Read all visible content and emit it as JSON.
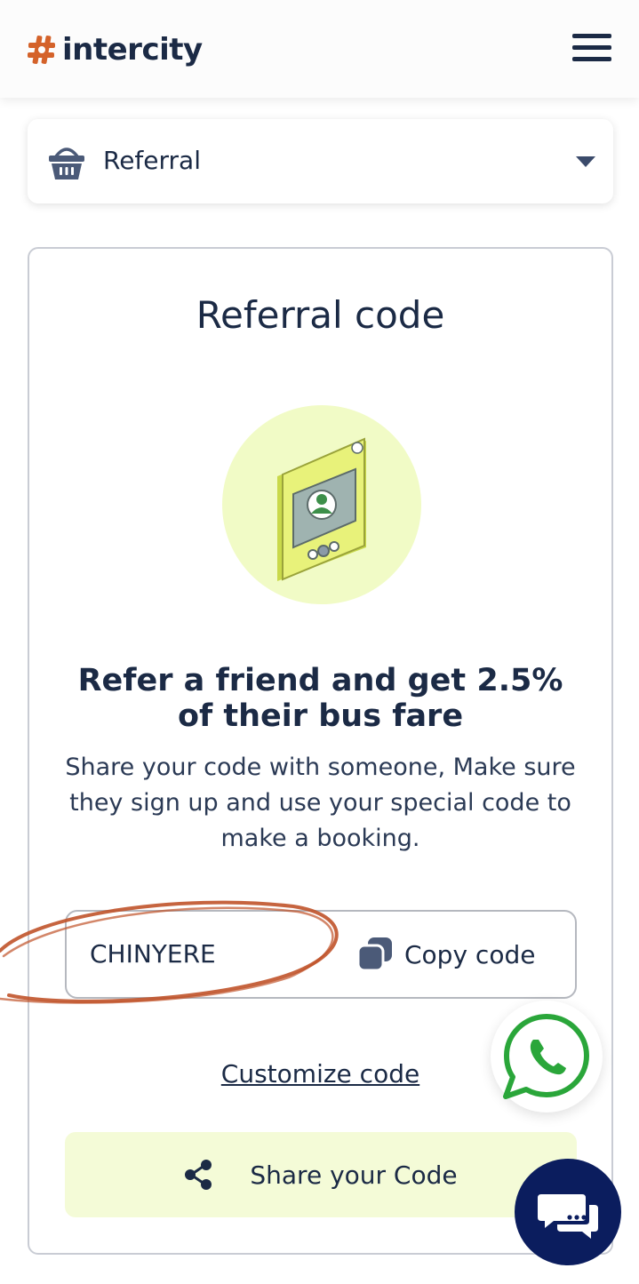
{
  "header": {
    "brand": "intercity",
    "menu_icon": "hamburger-menu-icon"
  },
  "section_select": {
    "icon": "basket-icon",
    "selected": "Referral"
  },
  "referral": {
    "title": "Referral code",
    "headline": "Refer a friend and get 2.5% of their bus fare",
    "description": "Share your code with someone, Make sure they sign up and use your special code to make a booking.",
    "code": "CHINYERE",
    "copy_label": "Copy code",
    "customize_label": "Customize code",
    "share_label": "Share your Code"
  },
  "colors": {
    "brand_orange": "#d4622a",
    "navy": "#1b2a45",
    "share_bg": "#f4fbd7",
    "chat_navy": "#0b1d5e",
    "whatsapp_green": "#2aa63a"
  }
}
